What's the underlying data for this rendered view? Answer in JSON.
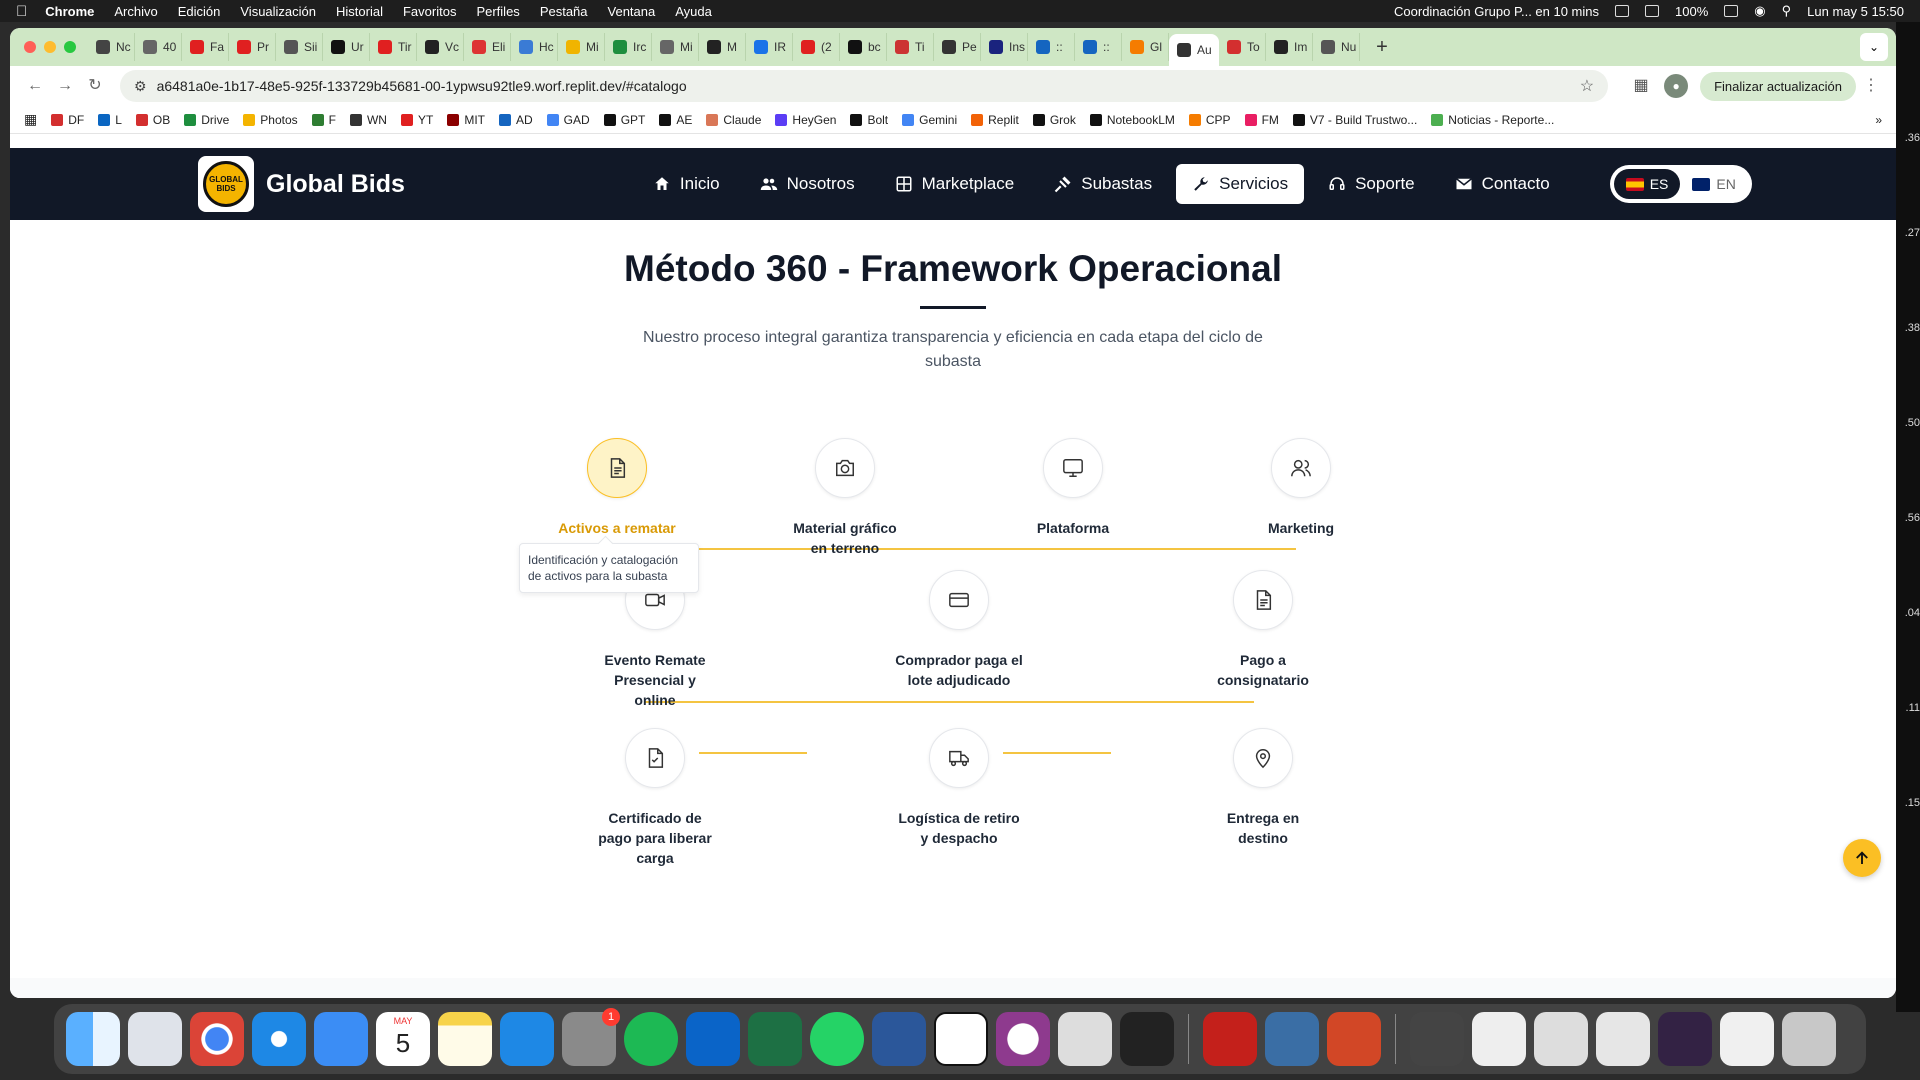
{
  "menubar": {
    "app": "Chrome",
    "menus": [
      "Archivo",
      "Edición",
      "Visualización",
      "Historial",
      "Favoritos",
      "Perfiles",
      "Pestaña",
      "Ventana",
      "Ayuda"
    ],
    "event": "Coordinación Grupo P... en 10 mins",
    "battery": "100%",
    "datetime": "Lun may 5  15:50"
  },
  "tabs": [
    {
      "label": "Nc",
      "color": "#444"
    },
    {
      "label": "40",
      "color": "#666"
    },
    {
      "label": "Fa",
      "color": "#e02020"
    },
    {
      "label": "Pr",
      "color": "#e02020"
    },
    {
      "label": "Sii",
      "color": "#555"
    },
    {
      "label": "Ur",
      "color": "#111"
    },
    {
      "label": "Tir",
      "color": "#e02020"
    },
    {
      "label": "Vc",
      "color": "#222"
    },
    {
      "label": "Eli",
      "color": "#d33"
    },
    {
      "label": "Hc",
      "color": "#3a7bd5"
    },
    {
      "label": "Mi",
      "color": "#f0b400"
    },
    {
      "label": "Irc",
      "color": "#1e8e3e"
    },
    {
      "label": "Mi",
      "color": "#666"
    },
    {
      "label": "M",
      "color": "#222"
    },
    {
      "label": "IR",
      "color": "#1a73e8"
    },
    {
      "label": "(2",
      "color": "#e02020"
    },
    {
      "label": "bc",
      "color": "#111"
    },
    {
      "label": "Ti",
      "color": "#c33"
    },
    {
      "label": "Pe",
      "color": "#333"
    },
    {
      "label": "Ins",
      "color": "#1a237e"
    },
    {
      "label": "::",
      "color": "#1565c0"
    },
    {
      "label": "::",
      "color": "#1565c0"
    },
    {
      "label": "Gl",
      "color": "#f57c00"
    },
    {
      "label": "Au",
      "color": "#333"
    },
    {
      "label": "To",
      "color": "#d32f2f"
    },
    {
      "label": "Im",
      "color": "#222"
    },
    {
      "label": "Nu",
      "color": "#555"
    }
  ],
  "active_tab_index": 23,
  "url": "a6481a0e-1b17-48e5-925f-133729b45681-00-1ypwsu92tle9.worf.replit.dev/#catalogo",
  "update_button": "Finalizar actualización",
  "bookmarks": [
    {
      "label": "DF",
      "color": "#d32f2f"
    },
    {
      "label": "L",
      "color": "#0a66c2"
    },
    {
      "label": "OB",
      "color": "#d32f2f"
    },
    {
      "label": "Drive",
      "color": "#1e8e3e"
    },
    {
      "label": "Photos",
      "color": "#f4b400"
    },
    {
      "label": "F",
      "color": "#2e7d32"
    },
    {
      "label": "WN",
      "color": "#333"
    },
    {
      "label": "YT",
      "color": "#e02020"
    },
    {
      "label": "MIT",
      "color": "#8b0000"
    },
    {
      "label": "AD",
      "color": "#1565c0"
    },
    {
      "label": "GAD",
      "color": "#4285f4"
    },
    {
      "label": "GPT",
      "color": "#111"
    },
    {
      "label": "AE",
      "color": "#111"
    },
    {
      "label": "Claude",
      "color": "#d97757"
    },
    {
      "label": "HeyGen",
      "color": "#5b3df5"
    },
    {
      "label": "Bolt",
      "color": "#111"
    },
    {
      "label": "Gemini",
      "color": "#4285f4"
    },
    {
      "label": "Replit",
      "color": "#f26207"
    },
    {
      "label": "Grok",
      "color": "#111"
    },
    {
      "label": "NotebookLM",
      "color": "#111"
    },
    {
      "label": "CPP",
      "color": "#f57c00"
    },
    {
      "label": "FM",
      "color": "#e91e63"
    },
    {
      "label": "V7 - Build Trustwo...",
      "color": "#111"
    },
    {
      "label": "Noticias - Reporte...",
      "color": "#4caf50"
    }
  ],
  "site": {
    "brand": "Global Bids",
    "logo_text": "GLOBAL BIDS",
    "nav": [
      {
        "label": "Inicio",
        "icon": "home-icon"
      },
      {
        "label": "Nosotros",
        "icon": "users-icon"
      },
      {
        "label": "Marketplace",
        "icon": "grid-icon"
      },
      {
        "label": "Subastas",
        "icon": "gavel-icon"
      },
      {
        "label": "Servicios",
        "icon": "wrench-icon"
      },
      {
        "label": "Soporte",
        "icon": "headset-icon"
      },
      {
        "label": "Contacto",
        "icon": "envelope-icon"
      }
    ],
    "active_nav": "Servicios",
    "lang": {
      "es": "ES",
      "en": "EN",
      "active": "ES"
    },
    "section": {
      "title": "Método 360 - Framework Operacional",
      "subtitle": "Nuestro proceso integral garantiza transparencia y eficiencia en cada etapa del ciclo de subasta"
    },
    "steps": [
      {
        "label": "Activos a rematar",
        "icon": "document-icon",
        "active": true
      },
      {
        "label": "Material gráfico en terreno",
        "icon": "camera-icon"
      },
      {
        "label": "Plataforma",
        "icon": "monitor-icon"
      },
      {
        "label": "Marketing",
        "icon": "users-icon"
      },
      {
        "label": "Evento Remate Presencial y online",
        "icon": "video-icon"
      },
      {
        "label": "Comprador paga el lote adjudicado",
        "icon": "credit-card-icon"
      },
      {
        "label": "Pago a consignatario",
        "icon": "document-icon"
      },
      {
        "label": "Certificado de pago para liberar carga",
        "icon": "file-check-icon"
      },
      {
        "label": "Logística de retiro y despacho",
        "icon": "truck-icon"
      },
      {
        "label": "Entrega en destino",
        "icon": "map-pin-icon"
      }
    ],
    "tooltip": "Identificación y catalogación de activos para la subasta",
    "accent": "#fbbf24",
    "nav_bg": "#111827"
  },
  "dock": {
    "calendar_month": "MAY",
    "calendar_day": "5",
    "settings_badge": "1"
  },
  "desktop_strip": [
    ".36",
    ".27",
    ".38",
    ".50",
    ".56",
    ".04",
    ".11",
    ".15"
  ]
}
